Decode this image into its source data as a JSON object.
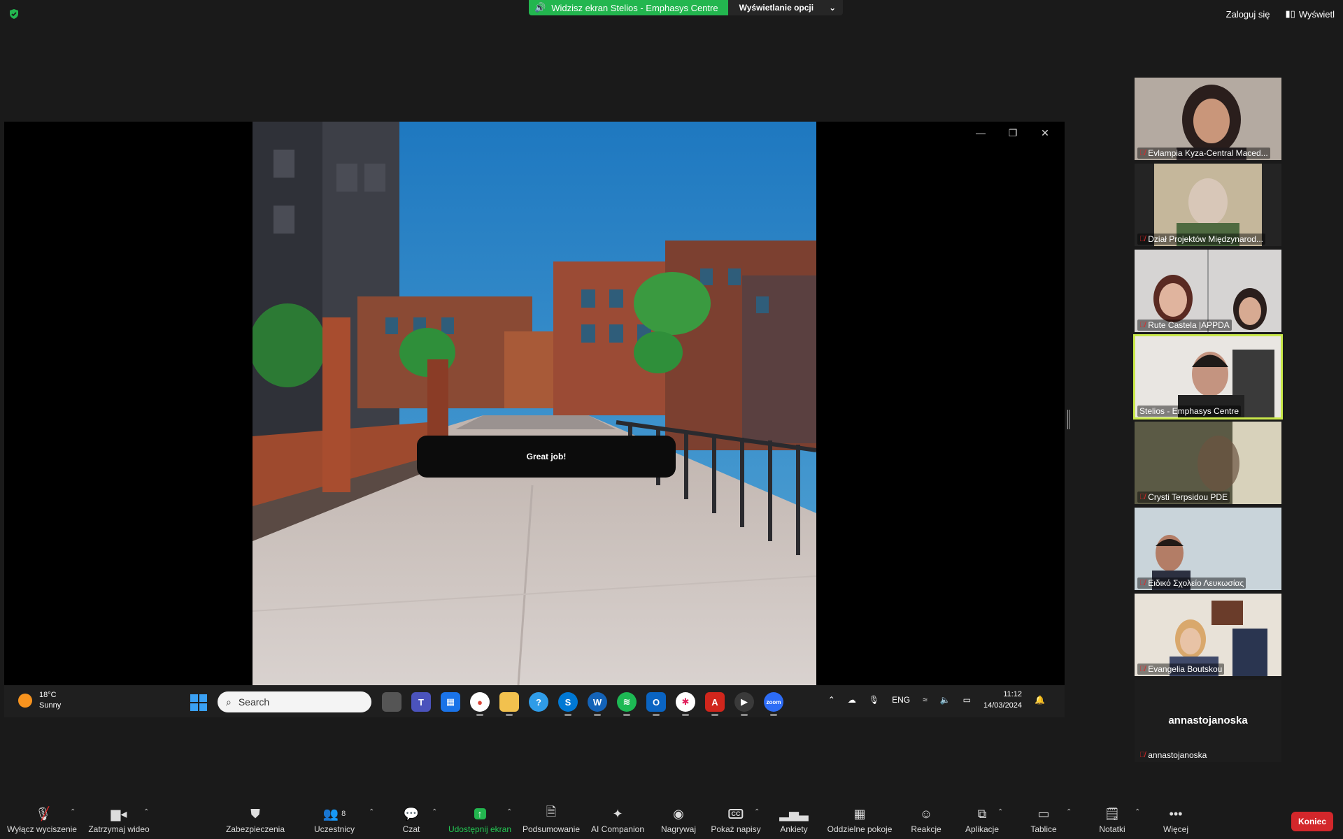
{
  "top": {
    "share_text": "Widzisz ekran Stelios - Emphasys Centre",
    "view_options": "Wyświetlanie opcji",
    "login": "Zaloguj się",
    "view": "Wyświetl"
  },
  "game": {
    "toast": "Great job!"
  },
  "taskbar": {
    "temp": "18°C",
    "weather": "Sunny",
    "search_placeholder": "Search",
    "lang": "ENG",
    "time": "11:12",
    "date": "14/03/2024"
  },
  "participants": [
    {
      "name": "Evlampia Kyza-Central Maced..."
    },
    {
      "name": "Dział Projektów Międzynarod..."
    },
    {
      "name": "Rute Castela |APPDA"
    },
    {
      "name": "Stelios - Emphasys Centre"
    },
    {
      "name": "Crysti Terpsidou PDE"
    },
    {
      "name": "Ειδικό Σχολείο Λευκωσίας"
    },
    {
      "name": "Evangelia Boutskou"
    },
    {
      "name": "annastojanoska",
      "big": "annastojanoska"
    }
  ],
  "toolbar": {
    "mute": "Wyłącz wyciszenie",
    "video": "Zatrzymaj wideo",
    "security": "Zabezpieczenia",
    "participants": "Uczestnicy",
    "participants_count": "8",
    "chat": "Czat",
    "share": "Udostępnij ekran",
    "summary": "Podsumowanie",
    "ai": "AI Companion",
    "record": "Nagrywaj",
    "captions": "Pokaż napisy",
    "polls": "Ankiety",
    "rooms": "Oddzielne pokoje",
    "reactions": "Reakcje",
    "apps": "Aplikacje",
    "whiteboards": "Tablice",
    "notes": "Notatki",
    "more": "Więcej",
    "end": "Koniec"
  },
  "colors": {
    "share_green": "#23b64f",
    "speaker_outline": "#c9e84a",
    "end_red": "#d3272b"
  }
}
